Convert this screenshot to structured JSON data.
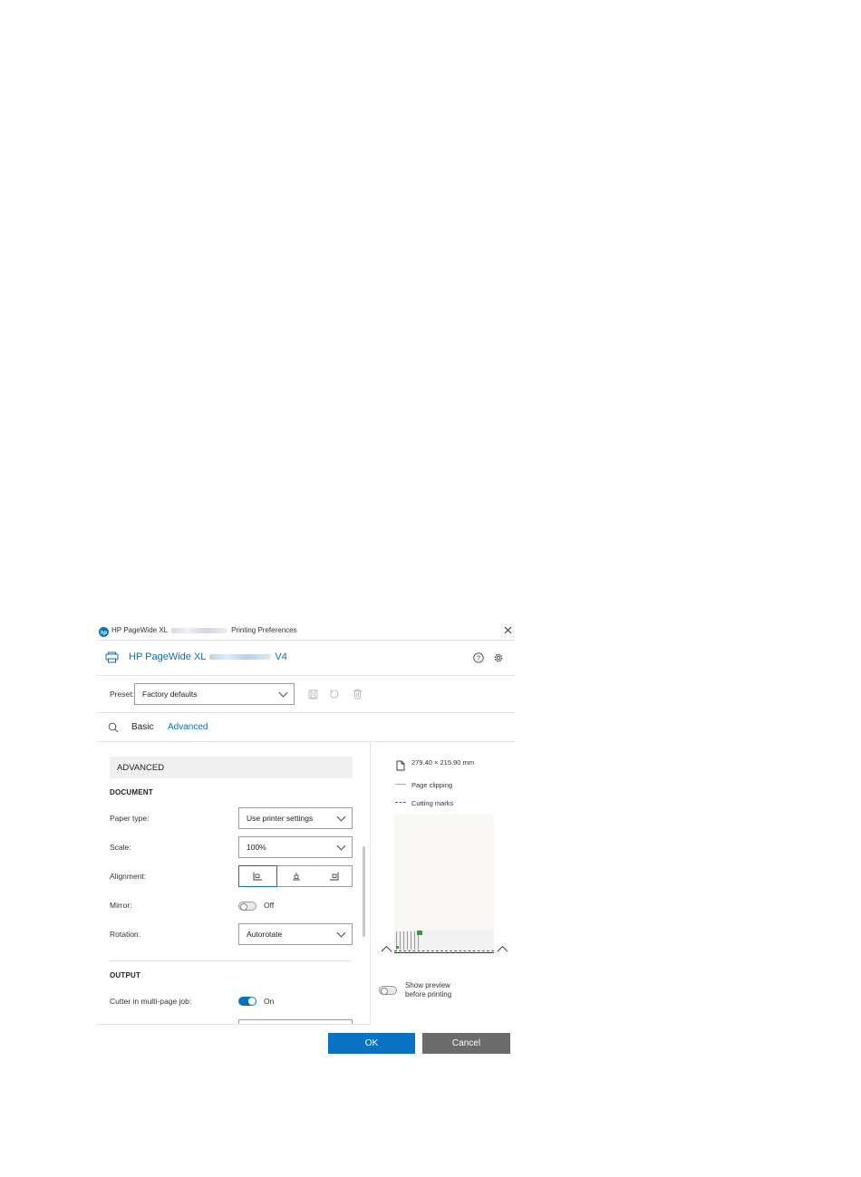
{
  "window": {
    "title_prefix": "HP PageWide XL",
    "title_suffix": "Printing Preferences"
  },
  "header": {
    "printer_prefix": "HP PageWide XL",
    "printer_suffix": "V4"
  },
  "preset": {
    "label": "Preset:",
    "value": "Factory defaults"
  },
  "tabs": [
    {
      "label": "Basic",
      "active": false
    },
    {
      "label": "Advanced",
      "active": true
    }
  ],
  "advanced": {
    "heading": "ADVANCED",
    "document": {
      "heading": "DOCUMENT",
      "paper_type": {
        "label": "Paper type:",
        "value": "Use printer settings"
      },
      "scale": {
        "label": "Scale:",
        "value": "100%"
      },
      "alignment": {
        "label": "Alignment:"
      },
      "mirror": {
        "label": "Mirror:",
        "state": "Off"
      },
      "rotation": {
        "label": "Rotation:",
        "value": "Autorotate"
      }
    },
    "output": {
      "heading": "OUTPUT",
      "cutter": {
        "label": "Cutter in multi-page job:",
        "state": "On"
      }
    }
  },
  "preview": {
    "page_size": "279.40 × 215.90 mm",
    "legend_clipping": "Page clipping",
    "legend_cutting": "Cutting marks",
    "show_preview_line1": "Show preview",
    "show_preview_line2": "before printing"
  },
  "buttons": {
    "ok": "OK",
    "cancel": "Cancel"
  },
  "colors": {
    "accent": "#0a72c4",
    "cancel_bg": "#6b6b6b",
    "clipping": "#f0a800",
    "preview_paper": "#faf8f5"
  }
}
